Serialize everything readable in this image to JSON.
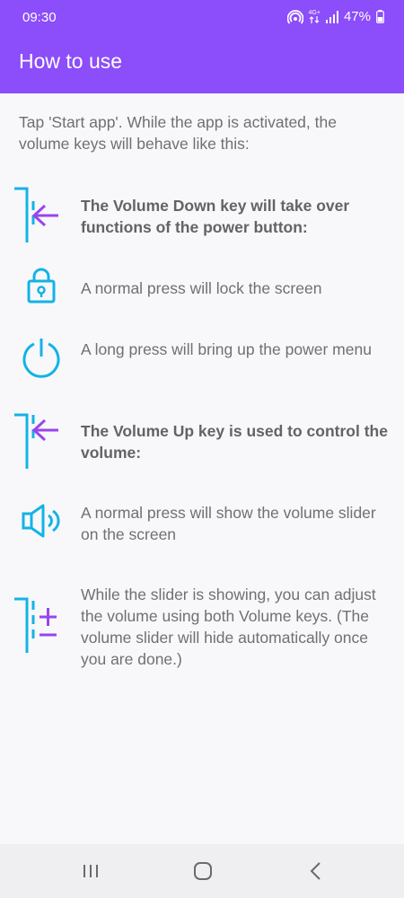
{
  "status_bar": {
    "time": "09:30",
    "network_label": "4G+",
    "battery": "47%",
    "icons": [
      "hotspot-icon",
      "signal-icon",
      "battery-icon"
    ]
  },
  "app_bar": {
    "title": "How to use"
  },
  "intro": "Tap 'Start app'. While the app is activated, the volume keys will behave like this:",
  "sections": {
    "volume_down_heading": "The Volume Down key will take over functions of the power button:",
    "lock_text": "A normal press will lock the screen",
    "power_text": "A long press will bring up the power menu",
    "volume_up_heading": "The Volume Up key is used to control the volume:",
    "speaker_text": "A normal press will show the volume slider on the screen",
    "adjust_text": "While the slider is showing, you can adjust the volume using both Volume keys. (The volume slider will hide automatically once you are done.)"
  },
  "nav_bar": {
    "buttons": [
      "recent-apps",
      "home",
      "back"
    ]
  },
  "colors": {
    "accent": "#8c4dfa",
    "icon_blue": "#12b3e6",
    "icon_purple": "#9945ee",
    "text": "#707070"
  }
}
